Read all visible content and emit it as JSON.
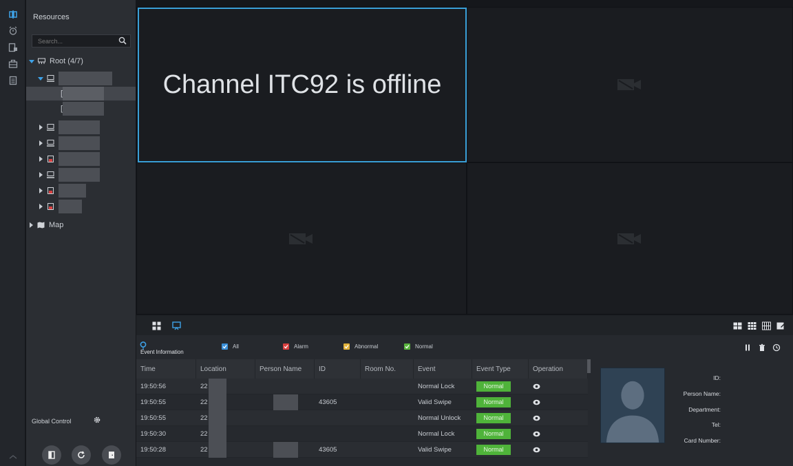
{
  "resources": {
    "title": "Resources",
    "search_placeholder": "Search...",
    "root_label": "Root (4/7)",
    "map_label": "Map",
    "global_control": "Global Control"
  },
  "video": {
    "offline_message": "Channel ITC92 is offline"
  },
  "events": {
    "title": "Event Information",
    "filters": [
      {
        "label": "All",
        "color": "#3a8fd8"
      },
      {
        "label": "Alarm",
        "color": "#d94040"
      },
      {
        "label": "Abnormal",
        "color": "#e2b23a"
      },
      {
        "label": "Normal",
        "color": "#58b33d"
      }
    ],
    "columns": [
      "Time",
      "Location",
      "Person Name",
      "ID",
      "Room No.",
      "Event",
      "Event Type",
      "Operation"
    ],
    "rows": [
      {
        "time": "19:50:56",
        "location": "22",
        "person": "",
        "id": "",
        "room": "",
        "event": "Normal Lock",
        "type": "Normal"
      },
      {
        "time": "19:50:55",
        "location": "22",
        "person": "",
        "id": "43605",
        "room": "",
        "event": "Valid Swipe",
        "type": "Normal"
      },
      {
        "time": "19:50:55",
        "location": "22",
        "person": "",
        "id": "",
        "room": "",
        "event": "Normal Unlock",
        "type": "Normal"
      },
      {
        "time": "19:50:30",
        "location": "22",
        "person": "",
        "id": "",
        "room": "",
        "event": "Normal Lock",
        "type": "Normal"
      },
      {
        "time": "19:50:28",
        "location": "22",
        "person": "",
        "id": "43605",
        "room": "",
        "event": "Valid Swipe",
        "type": "Normal"
      }
    ],
    "detail": {
      "id_label": "ID:",
      "name_label": "Person Name:",
      "dept_label": "Department:",
      "tel_label": "Tel:",
      "card_label": "Card Number:"
    }
  },
  "colors": {
    "accent": "#3aa0d8",
    "normal_badge": "#4fb33a"
  }
}
